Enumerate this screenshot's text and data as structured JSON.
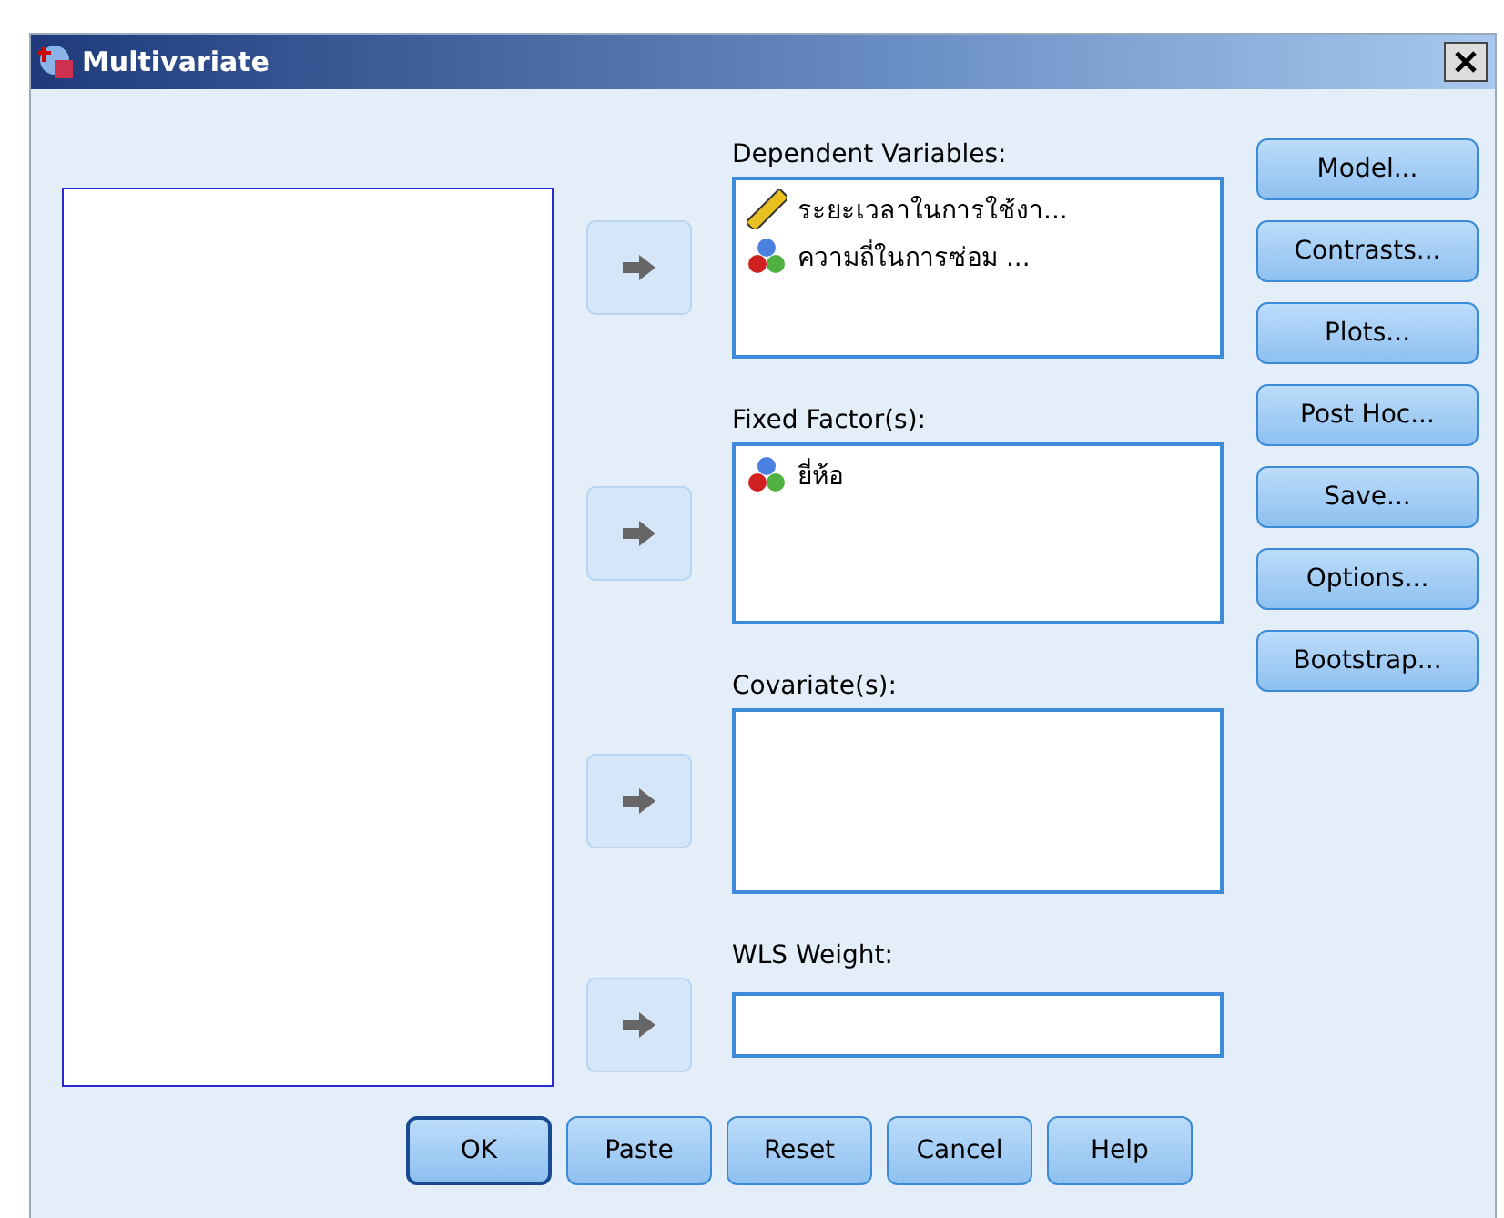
{
  "window": {
    "title": "Multivariate"
  },
  "targets": [
    {
      "label": "Dependent Variables:",
      "kind": "list",
      "items": [
        {
          "name": "ระยะเวลาในการใช้งา...",
          "kind": "scale"
        },
        {
          "name": "ความถี่ในการซ่อม ...",
          "kind": "nominal"
        }
      ]
    },
    {
      "label": "Fixed Factor(s):",
      "kind": "list",
      "items": [
        {
          "name": "ยี่ห้อ",
          "kind": "nominal"
        }
      ]
    },
    {
      "label": "Covariate(s):",
      "kind": "list"
    },
    {
      "label": "WLS Weight:",
      "kind": "field"
    }
  ],
  "side_buttons": [
    "Model...",
    "Contrasts...",
    "Plots...",
    "Post Hoc...",
    "Save...",
    "Options...",
    "Bootstrap..."
  ],
  "bottom_buttons": [
    {
      "label": "OK",
      "default": true
    },
    {
      "label": "Paste",
      "default": false
    },
    {
      "label": "Reset",
      "default": false
    },
    {
      "label": "Cancel",
      "default": false
    },
    {
      "label": "Help",
      "default": false
    }
  ]
}
